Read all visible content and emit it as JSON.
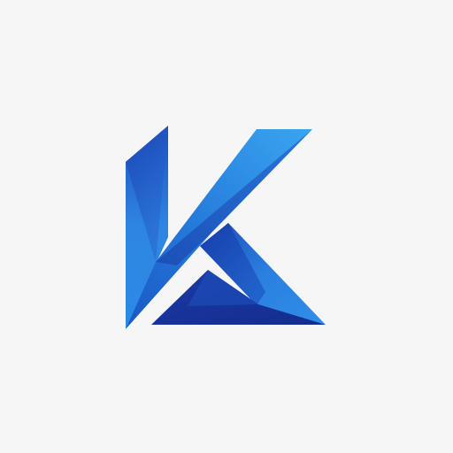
{
  "logo": {
    "letter": "K",
    "background_color": "#f6f6f7",
    "colors": {
      "light_blue": "#2f8de6",
      "mid_blue": "#1f67cf",
      "deep_blue": "#1638a8",
      "dark_navy": "#142c8e"
    }
  }
}
